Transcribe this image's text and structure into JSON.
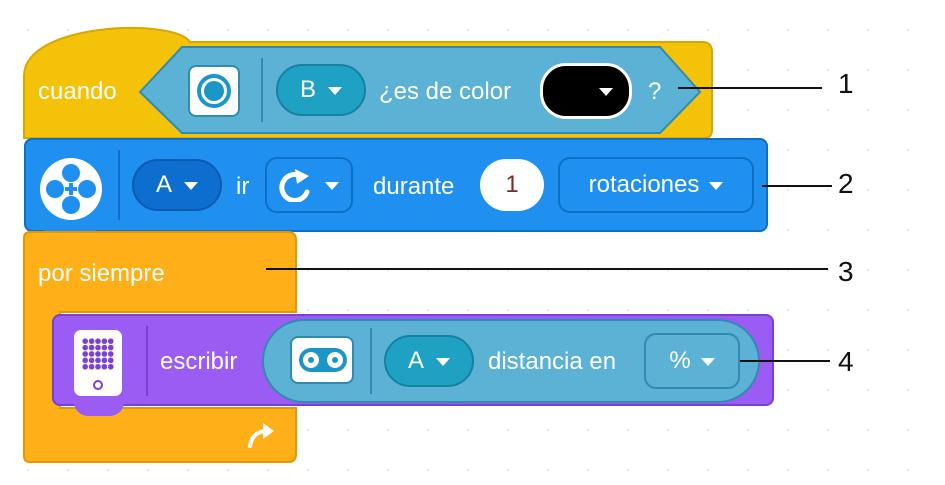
{
  "colors": {
    "event_block": "#f5c20a",
    "event_border": "#d9a800",
    "sensor_hex": "#5bb2d4",
    "sensor_hex_border": "#2f8cb0",
    "motor_block": "#1f8ff0",
    "motor_border": "#0e6fc6",
    "control_block": "#ffb019",
    "control_border": "#e59600",
    "display_block": "#9a5cf2",
    "display_border": "#7a3fd6"
  },
  "block1": {
    "hat_label": "cuando",
    "sensor_icon": "color-sensor-icon",
    "port": "B",
    "question_label": "¿es de color",
    "color_value": "black",
    "question_mark": "?"
  },
  "block2": {
    "motor_icon": "motor-icon",
    "port": "A",
    "label_go": "ir",
    "direction_icon": "clockwise-arrow-icon",
    "label_for": "durante",
    "amount": "1",
    "unit": "rotaciones"
  },
  "block3": {
    "label": "por siempre",
    "loop_icon": "loop-arrow-icon"
  },
  "block4": {
    "display_icon": "light-matrix-icon",
    "label": "escribir",
    "sensor_icon": "distance-sensor-icon",
    "port": "A",
    "label_distance": "distancia en",
    "unit": "%"
  },
  "callouts": [
    "1",
    "2",
    "3",
    "4"
  ]
}
